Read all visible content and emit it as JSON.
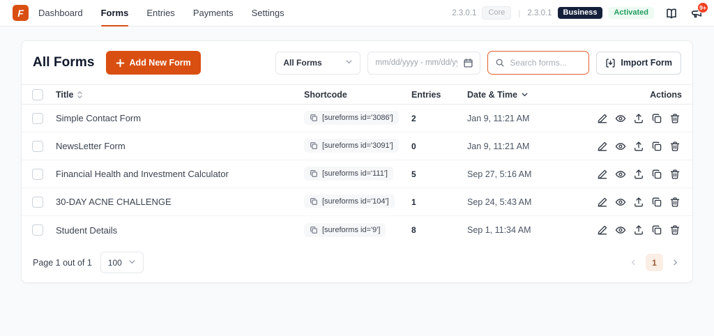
{
  "colors": {
    "accent": "#D94F12",
    "business_badge_bg": "#14203A",
    "activated_text": "#239D61",
    "notification_bg": "#EF4123",
    "current_page_bg": "#FAEEE5"
  },
  "topbar": {
    "logo_letter": "F",
    "nav": [
      {
        "label": "Dashboard",
        "active": false
      },
      {
        "label": "Forms",
        "active": true
      },
      {
        "label": "Entries",
        "active": false
      },
      {
        "label": "Payments",
        "active": false
      },
      {
        "label": "Settings",
        "active": false
      }
    ],
    "core_version": "2.3.0.1",
    "core_badge": "Core",
    "divider": "|",
    "pro_version": "2.3.0.1",
    "business_badge": "Business",
    "activated_badge": "Activated",
    "notification_count": "9+"
  },
  "toolbar": {
    "page_title": "All Forms",
    "add_new_form_label": "Add New Form",
    "forms_filter_value": "All Forms",
    "date_range_placeholder": "mm/dd/yyyy - mm/dd/yyyy",
    "search_placeholder": "Search forms...",
    "import_form_label": "Import Form"
  },
  "table": {
    "headers": {
      "title": "Title",
      "shortcode": "Shortcode",
      "entries": "Entries",
      "datetime": "Date & Time",
      "actions": "Actions"
    },
    "rows": [
      {
        "title": "Simple Contact Form",
        "shortcode": "[sureforms id='3086']",
        "entries": "2",
        "datetime": "Jan 9, 11:21 AM"
      },
      {
        "title": "NewsLetter Form",
        "shortcode": "[sureforms id='3091']",
        "entries": "0",
        "datetime": "Jan 9, 11:21 AM"
      },
      {
        "title": "Financial Health and Investment Calculator",
        "shortcode": "[sureforms id='111']",
        "entries": "5",
        "datetime": "Sep 27, 5:16 AM"
      },
      {
        "title": "30-DAY ACNE CHALLENGE",
        "shortcode": "[sureforms id='104']",
        "entries": "1",
        "datetime": "Sep 24, 5:43 AM"
      },
      {
        "title": "Student Details",
        "shortcode": "[sureforms id='9']",
        "entries": "8",
        "datetime": "Sep 1, 11:34 AM"
      }
    ]
  },
  "footer": {
    "page_info": "Page 1 out of 1",
    "per_page_value": "100",
    "current_page": "1"
  }
}
